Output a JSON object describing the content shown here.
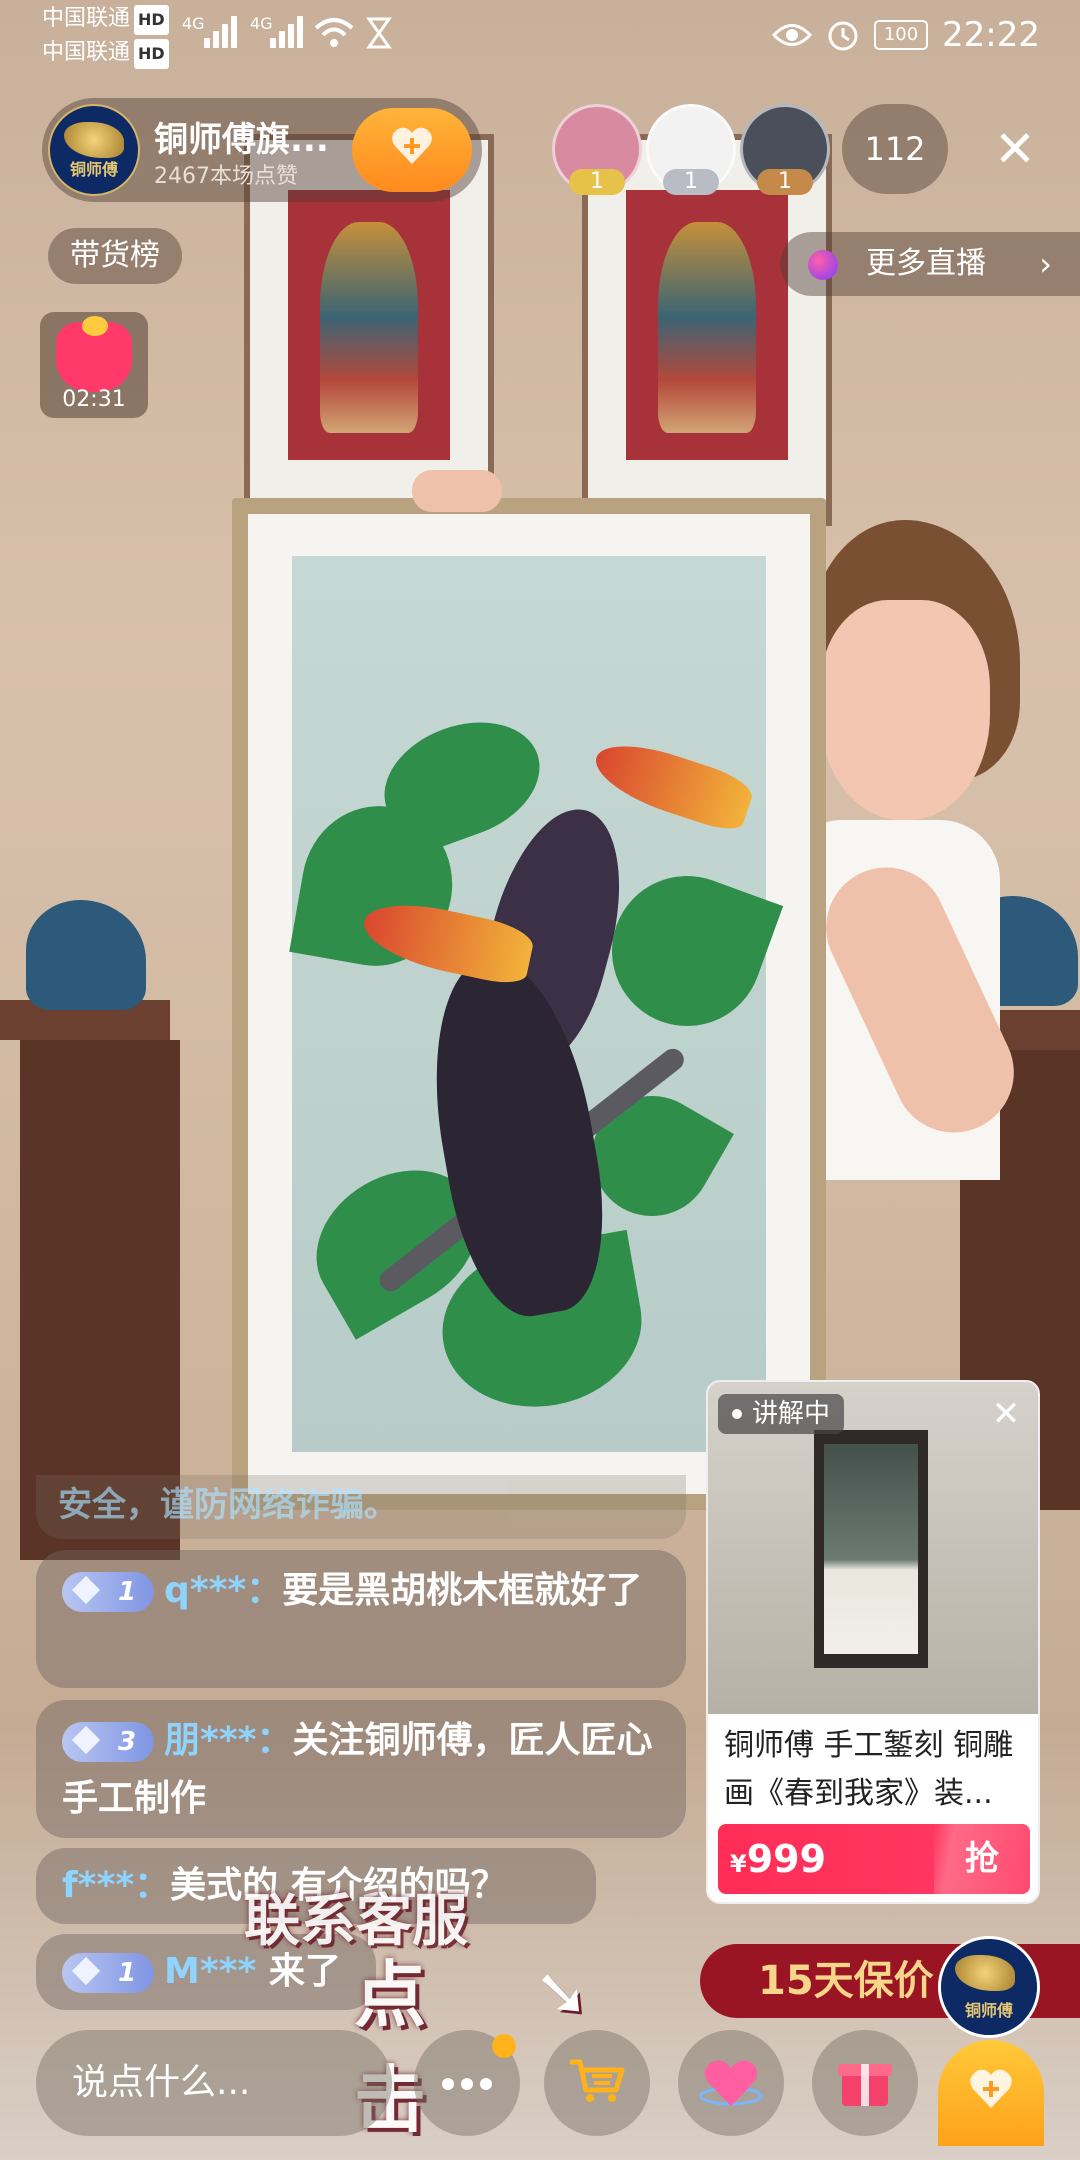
{
  "status_bar": {
    "carrier_1": "中国联通",
    "carrier_2": "中国联通",
    "hd": "HD",
    "net_1": "4G",
    "net_2": "4G",
    "battery": "100",
    "time": "22:22"
  },
  "host": {
    "name": "铜师傅旗...",
    "likes": "2467本场点赞",
    "avatar_text": "铜师傅"
  },
  "viewers": {
    "avatars": [
      {
        "badge": "1",
        "color": "#d78aa0"
      },
      {
        "badge": "1",
        "color": "#f2f2f2"
      },
      {
        "badge": "1",
        "color": "#4a4f5a"
      }
    ],
    "count": "112"
  },
  "close_icon": "✕",
  "rank_label": "带货榜",
  "more_live": {
    "label": "更多直播",
    "chevron": "›"
  },
  "red_packet": {
    "timer": "02:31"
  },
  "chat": {
    "faded": "安全，谨防网络诈骗。",
    "messages": [
      {
        "level": "1",
        "user": "q***：",
        "text": "要是黑胡桃木框就好了"
      },
      {
        "level": "3",
        "user": "朋***：",
        "text": "关注铜师傅，匠人匠心手工制作"
      },
      {
        "level": "",
        "user": "f***：",
        "text": "美式的 有介绍的吗？"
      },
      {
        "level": "1",
        "user": "M***",
        "text": "来了"
      }
    ]
  },
  "product": {
    "status": "讲解中",
    "title": "铜师傅 手工錾刻 铜雕画《春到我家》装...",
    "currency": "¥",
    "price": "999",
    "buy_label": "抢"
  },
  "guarantee": "15天保价",
  "service_overlay": {
    "line1": "联系客服",
    "line2": "点击"
  },
  "bottom": {
    "comment_placeholder": "说点什么..."
  },
  "colors": {
    "accent_pink": "#ff2d57",
    "follow_orange": "#ff9a22",
    "username_blue": "#8fd3ff"
  }
}
